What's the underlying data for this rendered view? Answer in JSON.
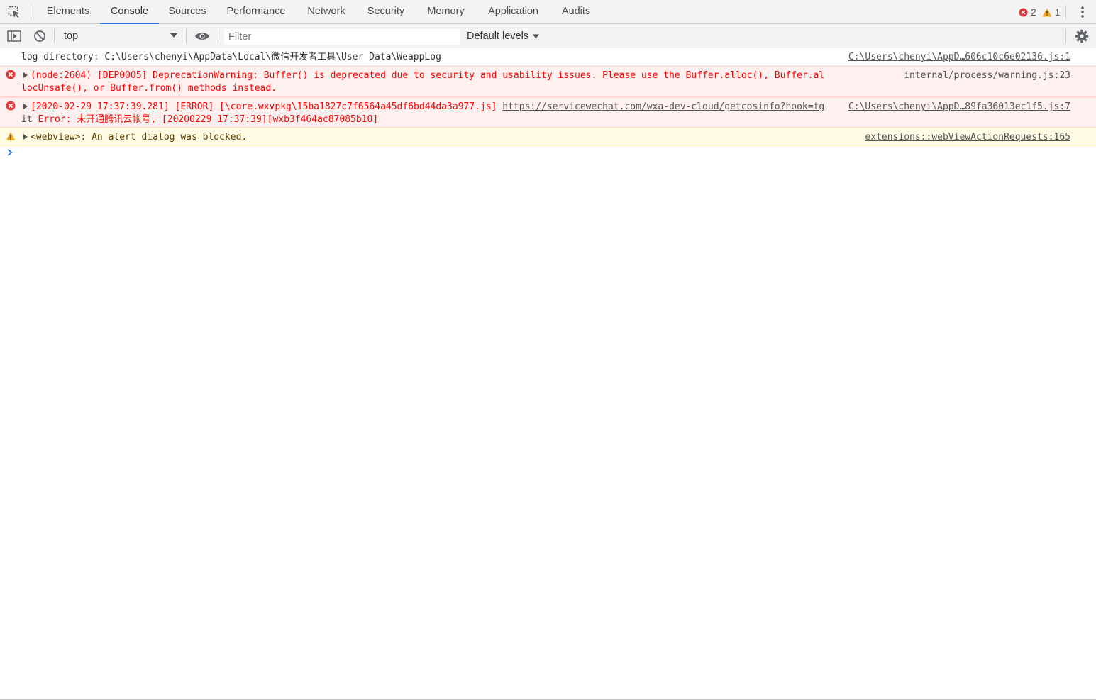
{
  "tabs": [
    {
      "label": "Elements",
      "active": false
    },
    {
      "label": "Console",
      "active": true
    },
    {
      "label": "Sources",
      "active": false
    },
    {
      "label": "Performance",
      "active": false
    },
    {
      "label": "Network",
      "active": false
    },
    {
      "label": "Security",
      "active": false
    },
    {
      "label": "Memory",
      "active": false
    },
    {
      "label": "Application",
      "active": false
    },
    {
      "label": "Audits",
      "active": false
    }
  ],
  "counters": {
    "errors": "2",
    "warnings": "1"
  },
  "toolbar": {
    "context": "top",
    "filter_placeholder": "Filter",
    "levels": "Default levels"
  },
  "messages": [
    {
      "level": "log",
      "text": "log directory: C:\\Users\\chenyi\\AppData\\Local\\微信开发者工具\\User Data\\WeappLog",
      "source": "C:\\Users\\chenyi\\AppD…606c10c6e02136.js:1"
    },
    {
      "level": "error",
      "text": "(node:2604) [DEP0005] DeprecationWarning: Buffer() is deprecated due to security and usability issues. Please use the Buffer.alloc(), Buffer.allocUnsafe(), or Buffer.from() methods instead.",
      "source": "internal/process/warning.js:23"
    },
    {
      "level": "error",
      "text_before": "[2020-02-29 17:37:39.281] [ERROR] [\\core.wxvpkg\\15ba1827c7f6564a45df6bd44da3a977.js] ",
      "link": "https://servicewechat.com/wxa-dev-cloud/getcosinfo?hook=tgit",
      "text_after": " Error: 未开通腾讯云帐号, [20200229 17:37:39][wxb3f464ac87085b10]",
      "source": "C:\\Users\\chenyi\\AppD…89fa36013ec1f5.js:7"
    },
    {
      "level": "warning",
      "text": "<webview>: An alert dialog was blocked.",
      "source": "extensions::webViewActionRequests:165"
    }
  ],
  "colors": {
    "accent": "#1a73e8",
    "error_text": "#ff0000",
    "error_bg": "#fff0f0",
    "warn_bg": "#fffbe5",
    "warn_icon": "#f2ab26",
    "error_icon": "#e63a3a"
  },
  "icons": {
    "inspect": "inspect-element-icon",
    "more": "kebab-menu-icon",
    "sidebar": "show-sidebar-icon",
    "clear": "clear-console-icon",
    "eye": "live-expression-icon",
    "settings": "gear-icon"
  }
}
